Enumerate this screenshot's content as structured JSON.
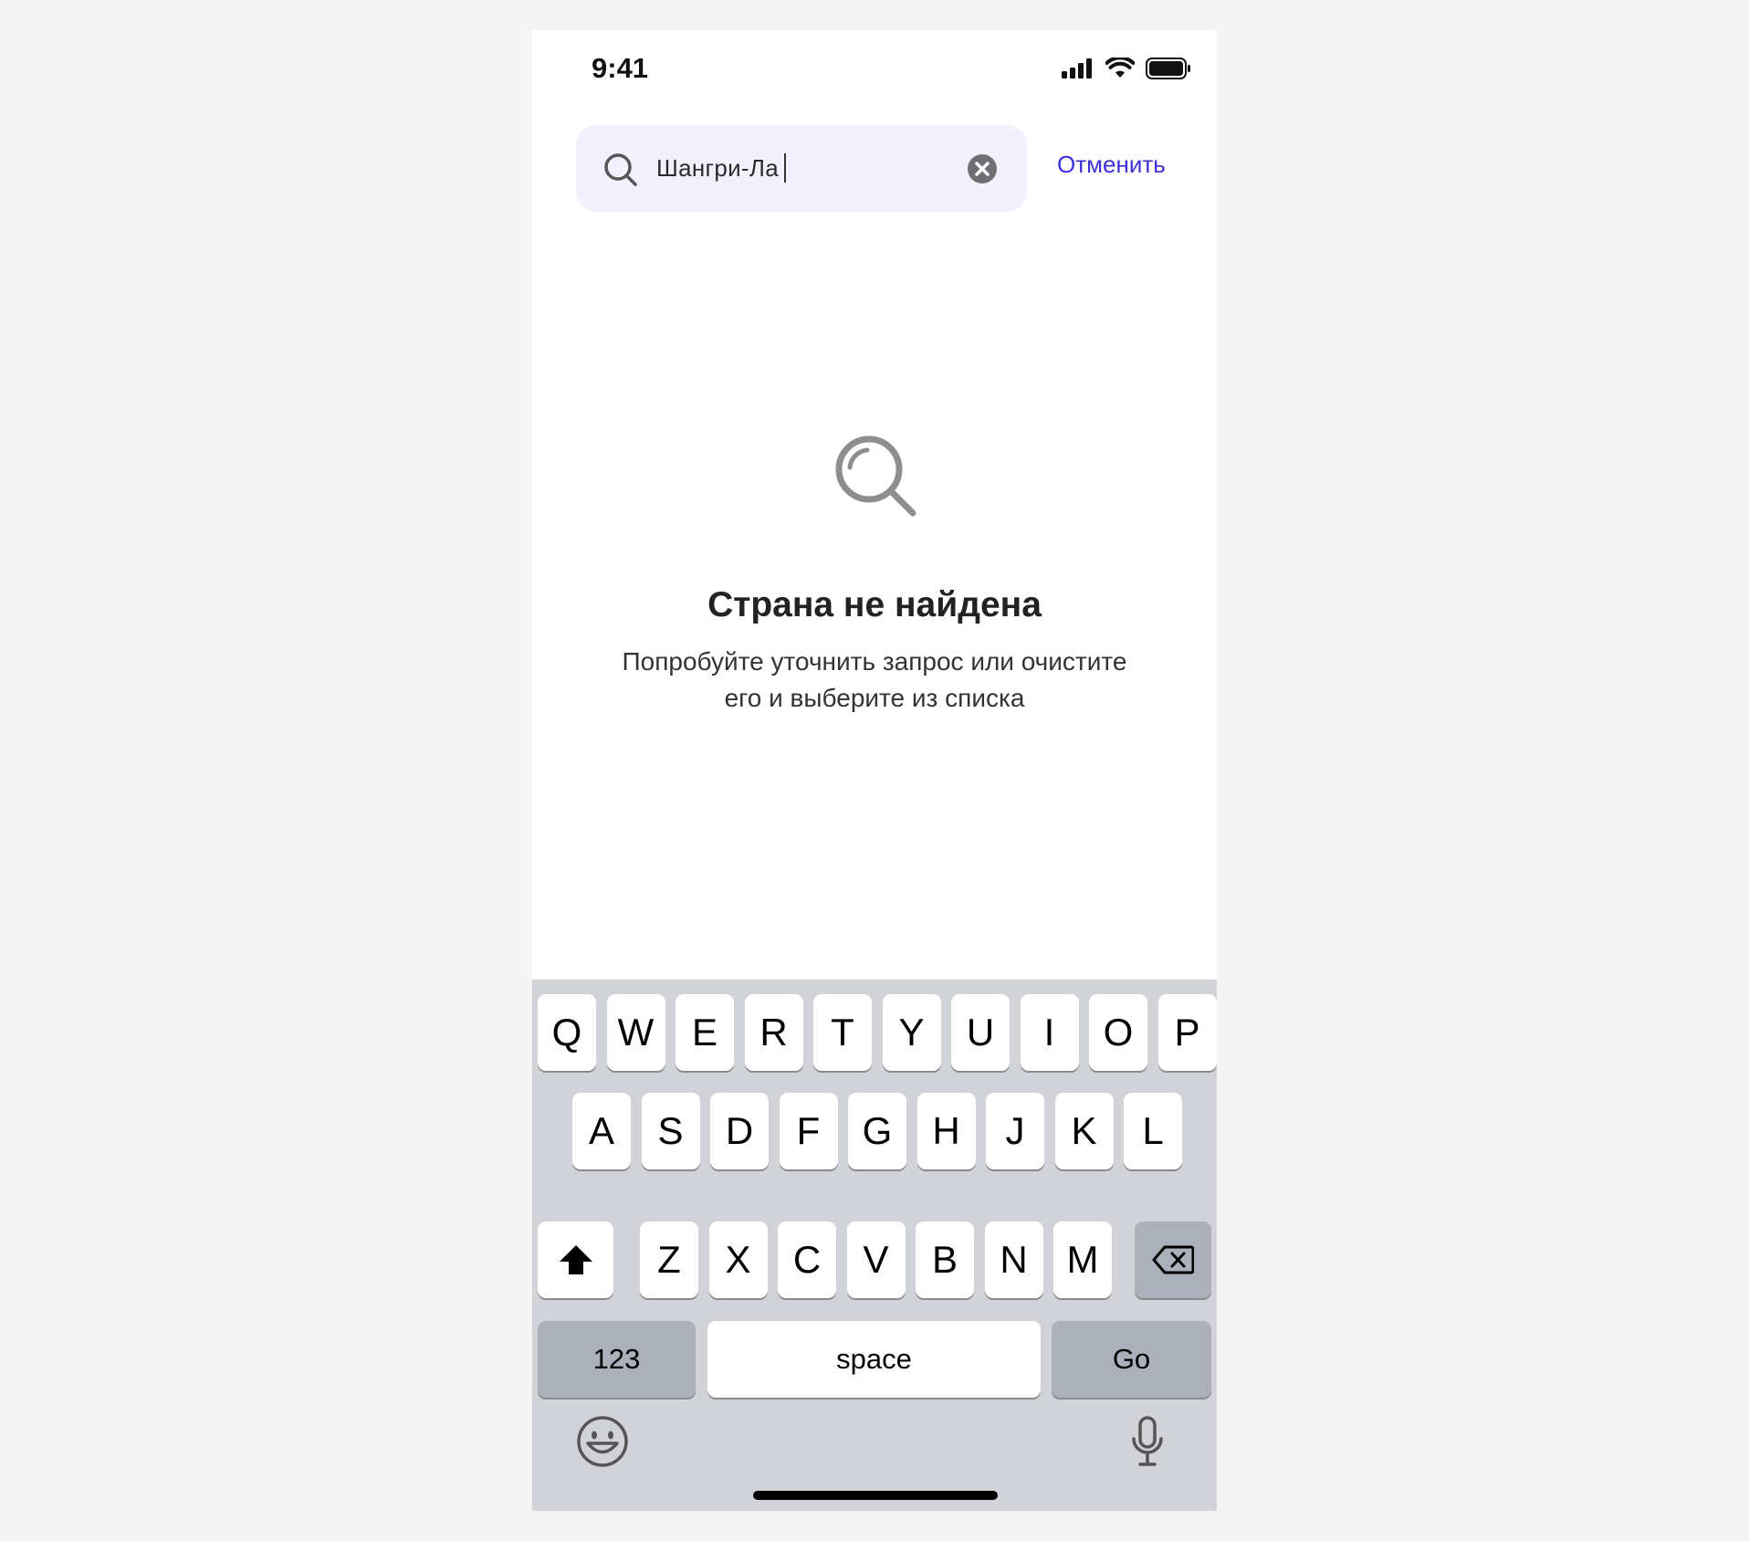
{
  "status_bar": {
    "time": "9:41"
  },
  "search": {
    "query": "Шангри-Ла",
    "cancel_label": "Отменить"
  },
  "empty_state": {
    "title": "Страна не найдена",
    "description_line1": "Попробуйте уточнить запрос или очистите",
    "description_line2": "его и выберите из списка"
  },
  "keyboard": {
    "row1": [
      "Q",
      "W",
      "E",
      "R",
      "T",
      "Y",
      "U",
      "I",
      "O",
      "P"
    ],
    "row2": [
      "A",
      "S",
      "D",
      "F",
      "G",
      "H",
      "J",
      "K",
      "L"
    ],
    "row3": [
      "Z",
      "X",
      "C",
      "V",
      "B",
      "N",
      "M"
    ],
    "numbers_label": "123",
    "space_label": "space",
    "go_label": "Go"
  },
  "colors": {
    "accent": "#3d2fd8",
    "search_bg": "#f3f1fd",
    "keyboard_bg": "#d1d3d9"
  }
}
